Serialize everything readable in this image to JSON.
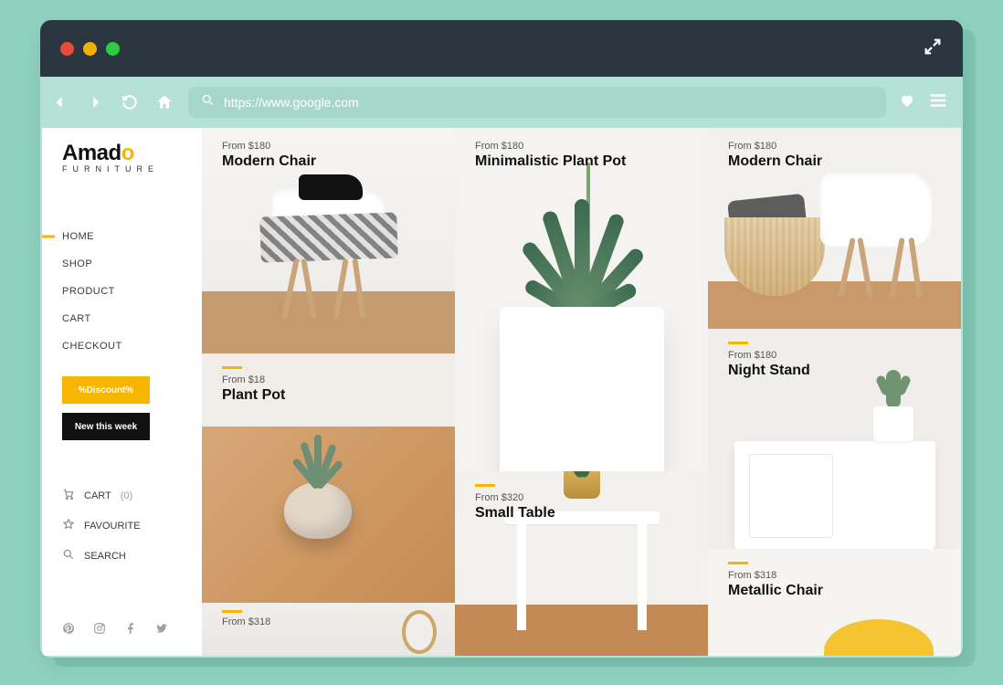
{
  "browser": {
    "url": "https://www.google.com"
  },
  "brand": {
    "name_prefix": "Amad",
    "name_accent": "o",
    "subtitle": "FURNITURE"
  },
  "nav": {
    "items": [
      {
        "label": "HOME",
        "active": true
      },
      {
        "label": "SHOP"
      },
      {
        "label": "PRODUCT"
      },
      {
        "label": "CART"
      },
      {
        "label": "CHECKOUT"
      }
    ]
  },
  "cta": {
    "discount": "%Discount%",
    "new": "New this week"
  },
  "meta": {
    "cart_label": "CART",
    "cart_count": "(0)",
    "favourite": "FAVOURITE",
    "search": "SEARCH"
  },
  "products": {
    "col1": [
      {
        "price": "From $180",
        "title": "Modern Chair"
      },
      {
        "price": "From $18",
        "title": "Plant Pot"
      },
      {
        "price": "From $318",
        "title": ""
      }
    ],
    "col2": [
      {
        "price": "From $180",
        "title": "Minimalistic Plant Pot"
      },
      {
        "price": "From $320",
        "title": "Small Table"
      }
    ],
    "col3": [
      {
        "price": "From $180",
        "title": "Modern Chair"
      },
      {
        "price": "From $180",
        "title": "Night Stand"
      },
      {
        "price": "From $318",
        "title": "Metallic Chair"
      }
    ]
  },
  "colors": {
    "accent": "#f7b500",
    "page_bg": "#8fd1bf"
  }
}
